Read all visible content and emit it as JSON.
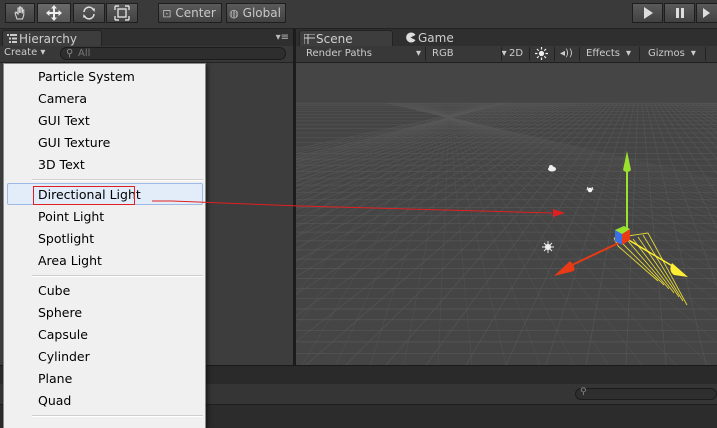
{
  "toolbar": {
    "center_label": "Center",
    "global_label": "Global"
  },
  "hierarchy": {
    "tab_label": "Hierarchy",
    "create_label": "Create ▾",
    "search_placeholder": "All"
  },
  "scene": {
    "tabs": [
      "Scene",
      "Game"
    ],
    "render_paths": "Render Paths",
    "rgb": "RGB",
    "mode_2d": "2D",
    "effects": "Effects",
    "gizmos": "Gizmos"
  },
  "menu": {
    "group1": [
      "Particle System",
      "Camera",
      "GUI Text",
      "GUI Texture",
      "3D Text"
    ],
    "group2": [
      "Directional Light",
      "Point Light",
      "Spotlight",
      "Area Light"
    ],
    "group3": [
      "Cube",
      "Sphere",
      "Capsule",
      "Cylinder",
      "Plane",
      "Quad"
    ],
    "highlighted": "Directional Light"
  },
  "colors": {
    "axis_y": "#9be22d",
    "axis_x": "#e83a14",
    "axis_z": "#3a6fe8",
    "light_gizmo": "#ffee33",
    "annotation": "#e02020"
  }
}
